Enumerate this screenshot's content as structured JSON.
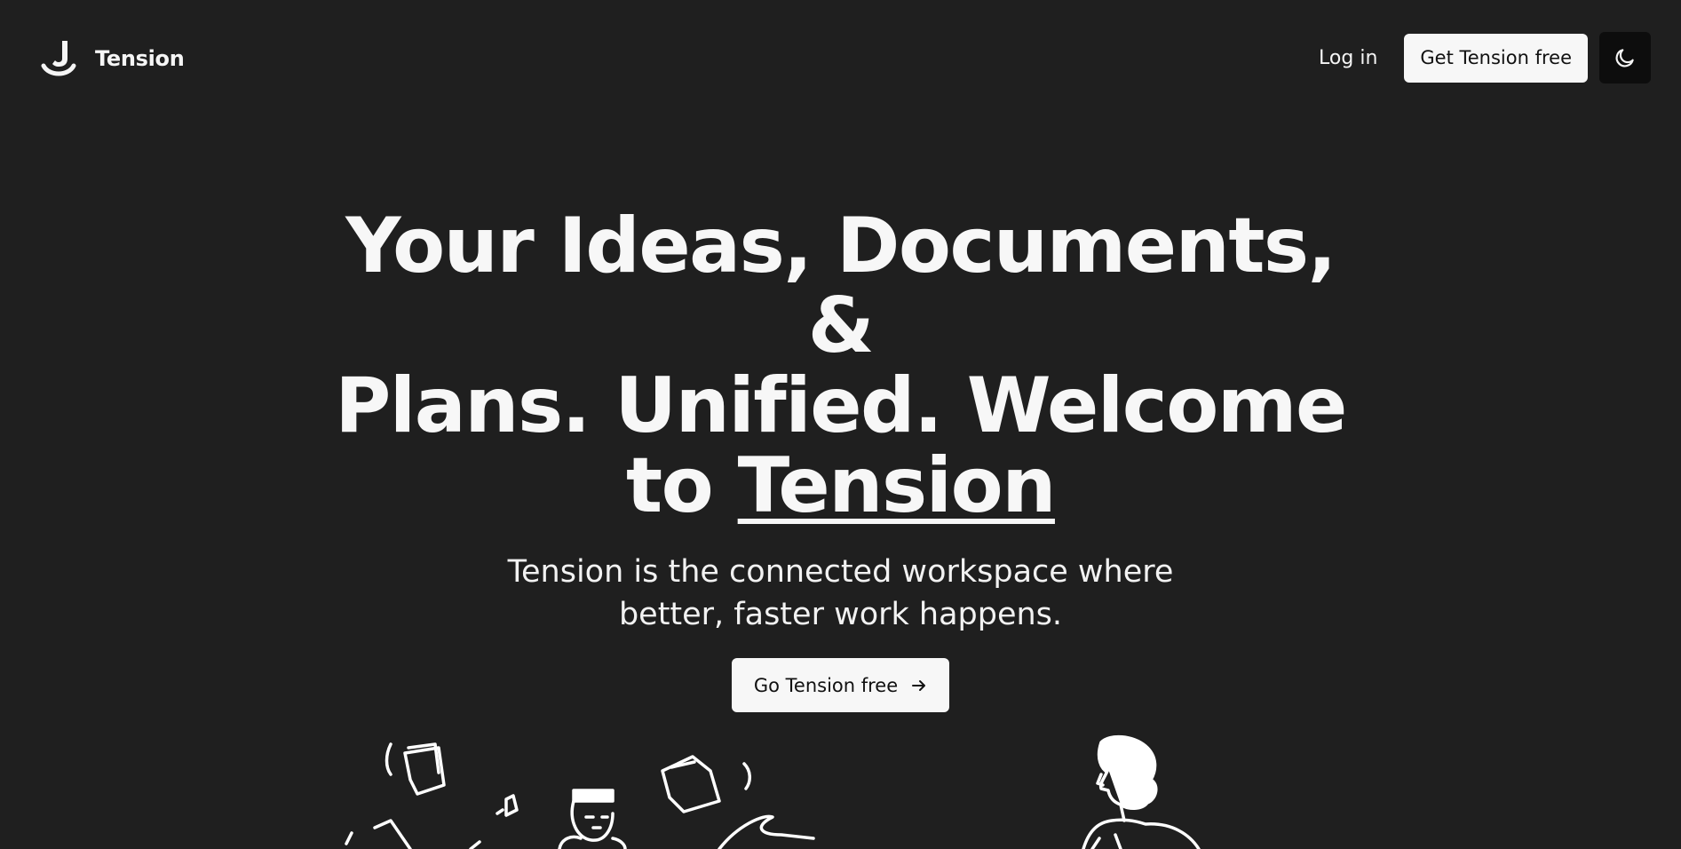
{
  "brand": {
    "name": "Tension"
  },
  "nav": {
    "login_label": "Log in",
    "cta_label": "Get Tension free",
    "theme_icon": "moon-icon"
  },
  "hero": {
    "title_line_1": "Your Ideas, Documents, &",
    "title_line_2": "Plans. Unified. Welcome",
    "title_line_3_prefix": "to ",
    "title_brand": "Tension",
    "subtitle_line_1": "Tension is the connected workspace where",
    "subtitle_line_2": "better, faster work happens.",
    "cta_label": "Go Tension free",
    "cta_icon": "arrow-right-icon"
  },
  "colors": {
    "background": "#1f1f1f",
    "text": "#f5f5f5",
    "button_bg": "#f7f7f7",
    "toggle_bg": "#0d0d0d"
  }
}
